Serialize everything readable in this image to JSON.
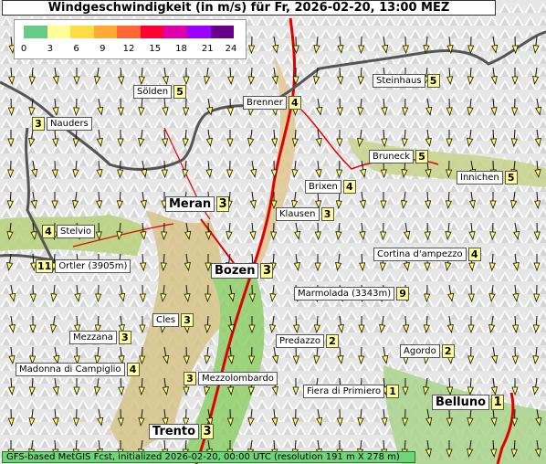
{
  "title": "Windgeschwindigkeit (in m/s) für Fr, 2026-02-20, 13:00 MEZ",
  "legend": {
    "ticks": [
      "0",
      "3",
      "6",
      "9",
      "12",
      "15",
      "18",
      "21",
      "24"
    ],
    "colors": [
      "#66cc88",
      "#ffff99",
      "#ffdd44",
      "#ffaa33",
      "#ff6633",
      "#ff0033",
      "#dd00aa",
      "#9900ff",
      "#660088"
    ]
  },
  "footer": "GFS-based MetGIS Fcst, initialized 2026-02-20, 00:00 UTC  (resolution 191 m X 278 m)",
  "stations": [
    {
      "name": "Sölden",
      "value": "5"
    },
    {
      "name": "Brenner",
      "value": "4"
    },
    {
      "name": "Steinhaus",
      "value": "5"
    },
    {
      "name": "Nauders",
      "value": "3"
    },
    {
      "name": "Bruneck",
      "value": "5"
    },
    {
      "name": "Innichen",
      "value": "5"
    },
    {
      "name": "Brixen",
      "value": "4"
    },
    {
      "name": "Meran",
      "value": "3"
    },
    {
      "name": "Klausen",
      "value": "3"
    },
    {
      "name": "Stelvio",
      "value": "4"
    },
    {
      "name": "Cortina d'ampezzo",
      "value": "4"
    },
    {
      "name": "Ortler (3905m)",
      "value": "11"
    },
    {
      "name": "Bozen",
      "value": "3"
    },
    {
      "name": "Marmolada (3343m)",
      "value": "9"
    },
    {
      "name": "Cles",
      "value": "3"
    },
    {
      "name": "Mezzana",
      "value": "3"
    },
    {
      "name": "Predazzo",
      "value": "2"
    },
    {
      "name": "Agordo",
      "value": "2"
    },
    {
      "name": "Madonna di Campiglio",
      "value": "4"
    },
    {
      "name": "Mezzolombardo",
      "value": "3"
    },
    {
      "name": "Fiera di Primiero",
      "value": "1"
    },
    {
      "name": "Belluno",
      "value": "1"
    },
    {
      "name": "Trento",
      "value": "3"
    }
  ]
}
